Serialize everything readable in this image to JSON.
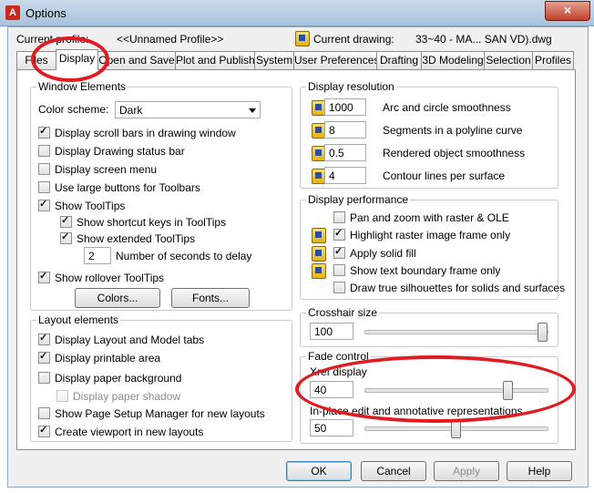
{
  "window": {
    "title": "Options",
    "close_glyph": "×",
    "app_icon_letter": "A"
  },
  "header": {
    "current_profile_label": "Current profile:",
    "current_profile_value": "<<Unnamed Profile>>",
    "current_drawing_label": "Current drawing:",
    "current_drawing_value": "33~40 - MA... SAN VD).dwg"
  },
  "tabs": [
    "Files",
    "Display",
    "Open and Save",
    "Plot and Publish",
    "System",
    "User Preferences",
    "Drafting",
    "3D Modeling",
    "Selection",
    "Profiles"
  ],
  "active_tab": "Display",
  "window_elements": {
    "title": "Window Elements",
    "color_scheme_label": "Color scheme:",
    "color_scheme_value": "Dark",
    "display_scroll_bars": "Display scroll bars in drawing window",
    "display_status_bar": "Display Drawing status bar",
    "display_screen_menu": "Display screen menu",
    "use_large_buttons": "Use large buttons for Toolbars",
    "show_tooltips": "Show ToolTips",
    "show_shortcut_keys": "Show shortcut keys in ToolTips",
    "show_extended_tooltips": "Show extended ToolTips",
    "seconds_value": "2",
    "seconds_label": "Number of seconds to delay",
    "show_rollover": "Show rollover ToolTips",
    "colors_button": "Colors...",
    "fonts_button": "Fonts..."
  },
  "layout_elements": {
    "title": "Layout elements",
    "display_layout_tabs": "Display Layout and Model tabs",
    "display_printable_area": "Display printable area",
    "display_paper_background": "Display paper background",
    "display_paper_shadow": "Display paper shadow",
    "show_page_setup": "Show Page Setup Manager for new layouts",
    "create_viewport": "Create viewport in new layouts"
  },
  "display_resolution": {
    "title": "Display resolution",
    "items": [
      {
        "value": "1000",
        "label": "Arc and circle smoothness"
      },
      {
        "value": "8",
        "label": "Segments in a polyline curve"
      },
      {
        "value": "0.5",
        "label": "Rendered object smoothness"
      },
      {
        "value": "4",
        "label": "Contour lines per surface"
      }
    ]
  },
  "display_performance": {
    "title": "Display performance",
    "pan_zoom": "Pan and zoom with raster & OLE",
    "highlight_raster": "Highlight raster image frame only",
    "apply_solid_fill": "Apply solid fill",
    "show_text_boundary": "Show text boundary frame only",
    "draw_silhouettes": "Draw true silhouettes for solids and surfaces"
  },
  "crosshair": {
    "title": "Crosshair size",
    "value": "100",
    "level": 1.0
  },
  "fade_control": {
    "title": "Fade control",
    "xref_label": "Xref display",
    "xref_value": "40",
    "xref_level": 0.8,
    "inplace_label": "In-place edit and annotative representations",
    "inplace_value": "50",
    "inplace_level": 0.5
  },
  "footer": {
    "ok": "OK",
    "cancel": "Cancel",
    "apply": "Apply",
    "help": "Help"
  },
  "colors": {
    "annotation_red": "#e01b22",
    "title_bar": "#b9d1ea"
  }
}
